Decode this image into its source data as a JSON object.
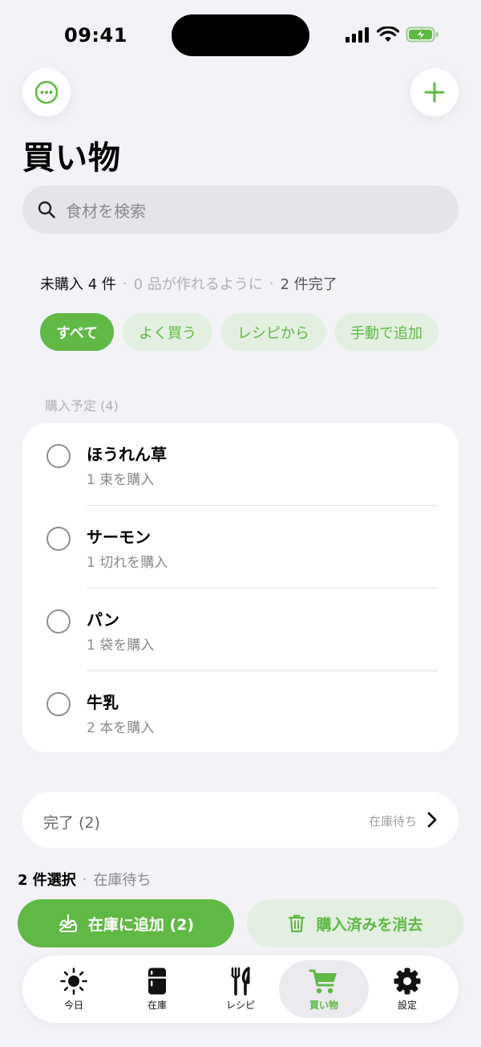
{
  "status": {
    "time": "09:41"
  },
  "header": {
    "title": "買い物",
    "more_icon": "ellipsis-circle-icon",
    "add_icon": "plus-icon"
  },
  "search": {
    "placeholder": "食材を検索"
  },
  "summary": {
    "unpurchased": "未購入 4 件",
    "makeable": "0 品が作れるように",
    "completed": "2 件完了"
  },
  "filters": [
    {
      "label": "すべて",
      "active": true
    },
    {
      "label": "よく買う",
      "active": false
    },
    {
      "label": "レシピから",
      "active": false
    },
    {
      "label": "手動で追加",
      "active": false
    }
  ],
  "list": {
    "section_label": "購入予定 (4)",
    "items": [
      {
        "name": "ほうれん草",
        "qty": "1 束を購入"
      },
      {
        "name": "サーモン",
        "qty": "1 切れを購入"
      },
      {
        "name": "パン",
        "qty": "1 袋を購入"
      },
      {
        "name": "牛乳",
        "qty": "2 本を購入"
      }
    ]
  },
  "done": {
    "label": "完了 (2)",
    "sub": "在庫待ち"
  },
  "selection": {
    "count": "2 件選択",
    "state": "在庫待ち"
  },
  "actions": {
    "primary": "在庫に追加 (2)",
    "secondary": "購入済みを消去"
  },
  "tabs": [
    {
      "label": "今日",
      "icon": "sun-icon",
      "active": false
    },
    {
      "label": "在庫",
      "icon": "fridge-icon",
      "active": false
    },
    {
      "label": "レシピ",
      "icon": "fork-knife-icon",
      "active": false
    },
    {
      "label": "買い物",
      "icon": "cart-icon",
      "active": true
    },
    {
      "label": "設定",
      "icon": "gear-icon",
      "active": false
    }
  ],
  "colors": {
    "accent": "#5fb944",
    "accent_light": "#e3efe0",
    "background": "#f2f2f7"
  }
}
